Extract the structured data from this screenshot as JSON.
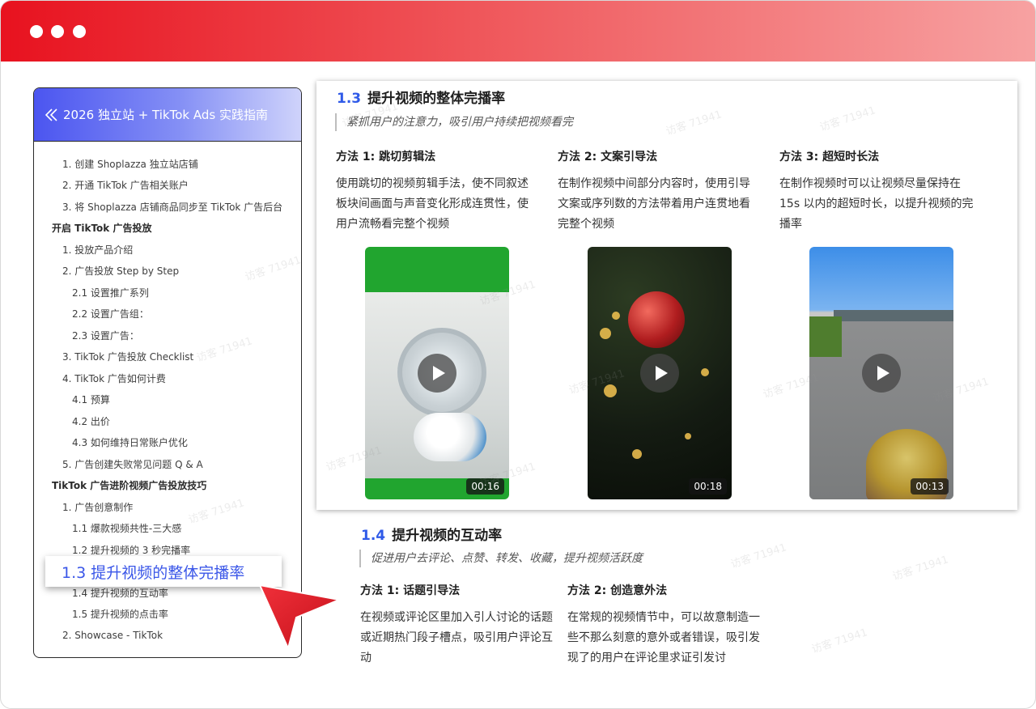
{
  "sidebar": {
    "title": "2026 独立站 + TikTok Ads 实践指南",
    "items": [
      {
        "label": "1. 创建 Shoplazza 独立站店铺",
        "level": "l1"
      },
      {
        "label": "2. 开通 TikTok 广告相关账户",
        "level": "l1"
      },
      {
        "label": "3. 将 Shoplazza 店铺商品同步至 TikTok 广告后台",
        "level": "l1"
      },
      {
        "label": "开启 TikTok 广告投放",
        "level": "sec"
      },
      {
        "label": "1. 投放产品介绍",
        "level": "l1"
      },
      {
        "label": "2. 广告投放 Step by Step",
        "level": "l1"
      },
      {
        "label": "2.1 设置推广系列",
        "level": "l2"
      },
      {
        "label": "2.2 设置广告组：",
        "level": "l2"
      },
      {
        "label": "2.3 设置广告：",
        "level": "l2"
      },
      {
        "label": "3. TikTok 广告投放 Checklist",
        "level": "l1"
      },
      {
        "label": "4. TikTok 广告如何计费",
        "level": "l1"
      },
      {
        "label": "4.1 预算",
        "level": "l2"
      },
      {
        "label": "4.2 出价",
        "level": "l2"
      },
      {
        "label": "4.3 如何维持日常账户优化",
        "level": "l2"
      },
      {
        "label": "5. 广告创建失败常见问题 Q & A",
        "level": "l1"
      },
      {
        "label": "TikTok 广告进阶视频广告投放技巧",
        "level": "sec"
      },
      {
        "label": "1. 广告创意制作",
        "level": "l1"
      },
      {
        "label": "1.1 爆款视频共性-三大感",
        "level": "l2"
      },
      {
        "label": "1.2 提升视频的 3 秒完播率",
        "level": "l2"
      },
      {
        "label": "",
        "level": "l2"
      },
      {
        "label": "1.4 提升视频的互动率",
        "level": "l2"
      },
      {
        "label": "1.5 提升视频的点击率",
        "level": "l2"
      },
      {
        "label": "2. Showcase - TikTok",
        "level": "l1"
      }
    ],
    "active_label": "1.3 提升视频的整体完播率"
  },
  "section13": {
    "num": "1.3",
    "title": "提升视频的整体完播率",
    "quote": "紧抓用户的注意力，吸引用户持续把视频看完",
    "methods": [
      {
        "title": "方法 1: 跳切剪辑法",
        "desc": "使用跳切的视频剪辑手法，使不同叙述板块间画面与声音变化形成连贯性，使用户流畅看完整个视频",
        "duration": "00:16"
      },
      {
        "title": "方法 2: 文案引导法",
        "desc": "在制作视频中间部分内容时，使用引导文案或序列数的方法带着用户连贯地看完整个视频",
        "duration": "00:18"
      },
      {
        "title": "方法 3: 超短时长法",
        "desc": "在制作视频时可以让视频尽量保持在 15s 以内的超短时长，以提升视频的完播率",
        "duration": "00:13"
      }
    ]
  },
  "section14": {
    "num": "1.4",
    "title": "提升视频的互动率",
    "quote": "促进用户去评论、点赞、转发、收藏，提升视频活跃度",
    "methods": [
      {
        "title": "方法 1: 话题引导法",
        "desc": "在视频或评论区里加入引人讨论的话题或近期热门段子槽点，吸引用户评论互动"
      },
      {
        "title": "方法 2: 创造意外法",
        "desc": "在常规的视频情节中，可以故意制造一些不那么刻意的意外或者错误，吸引发现了的用户在评论里求证引发讨"
      }
    ]
  },
  "watermark": "访客 71941",
  "colors": {
    "titlebar_start": "#e8121f",
    "accent_blue": "#2f5ae8",
    "cursor_red": "#e8121f"
  }
}
